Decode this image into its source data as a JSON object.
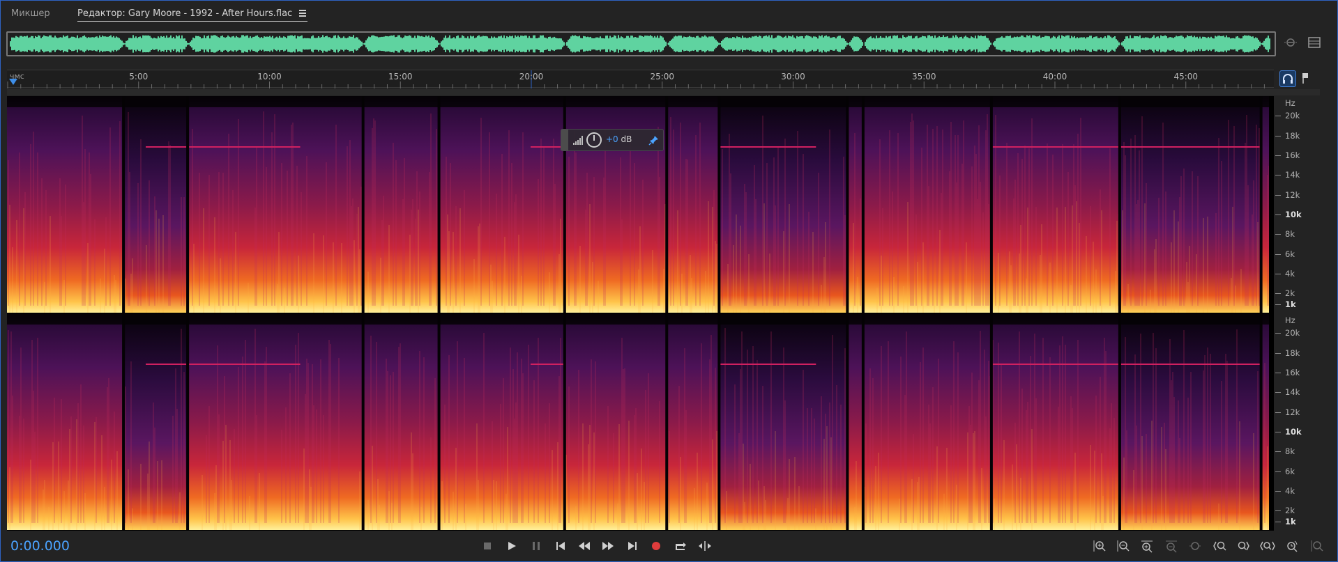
{
  "tabs": {
    "mixer": "Микшер",
    "editor": "Редактор: Gary Moore - 1992 - After Hours.flac"
  },
  "ruler": {
    "unit": "чмс",
    "labels": [
      "5:00",
      "10:00",
      "15:00",
      "20:00",
      "25:00",
      "30:00",
      "35:00",
      "40:00",
      "45:00"
    ]
  },
  "freq_axis": {
    "unit": "Hz",
    "labels": [
      "20k",
      "18k",
      "16k",
      "14k",
      "12k",
      "10k",
      "8k",
      "6k",
      "4k",
      "2k",
      "1k"
    ]
  },
  "hud": {
    "value": "+0",
    "unit": " dB"
  },
  "transport": {
    "time": "0:00.000"
  },
  "colors": {
    "accent": "#4ba3ff",
    "waveform": "#5fd3a0",
    "record": "#e03c3c",
    "frame": "#2f63c4"
  },
  "icons": {
    "editor_menu": "menu-icon",
    "overview_zoom": "zoom-out-full-icon",
    "overview_menu": "panel-menu-icon",
    "monitor": "headphones-icon",
    "marker": "marker-icon",
    "hud_pin": "pin-icon",
    "transport": [
      "stop-icon",
      "play-icon",
      "pause-icon",
      "skip-back-icon",
      "rewind-icon",
      "fast-forward-icon",
      "skip-forward-icon",
      "record-icon",
      "loop-icon",
      "skip-selection-icon"
    ],
    "zoom": [
      "zoom-in-amplitude-icon",
      "zoom-out-amplitude-icon",
      "zoom-in-time-icon",
      "zoom-out-time-icon",
      "zoom-reset-icon",
      "zoom-in-left-icon",
      "zoom-in-right-icon",
      "zoom-selection-icon",
      "zoom-full-icon",
      "zoom-out-full-icon"
    ]
  }
}
